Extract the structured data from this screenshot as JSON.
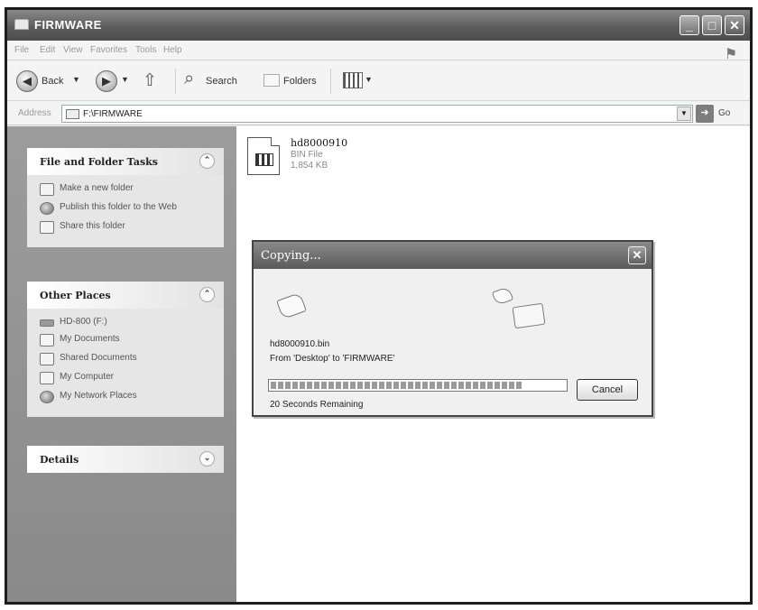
{
  "window": {
    "title": "FIRMWARE"
  },
  "titlebar_buttons": {
    "minimize": "_",
    "maximize": "□",
    "close": "✕"
  },
  "menu": [
    "File",
    "Edit",
    "View",
    "Favorites",
    "Tools",
    "Help"
  ],
  "toolbar": {
    "back_label": "Back",
    "search_label": "Search",
    "folders_label": "Folders"
  },
  "address": {
    "label": "Address",
    "path": "F:\\FIRMWARE",
    "go_label": "Go"
  },
  "sidebar": {
    "tasks": {
      "title": "File and Folder Tasks",
      "items": [
        {
          "label": "Make a new folder",
          "icon": "folder-new-icon"
        },
        {
          "label": "Publish this folder to the Web",
          "icon": "globe-icon"
        },
        {
          "label": "Share this folder",
          "icon": "share-icon"
        }
      ]
    },
    "other_places": {
      "title": "Other Places",
      "items": [
        {
          "label": "HD-800 (F:)",
          "icon": "drive-icon"
        },
        {
          "label": "My Documents",
          "icon": "documents-icon"
        },
        {
          "label": "Shared Documents",
          "icon": "shared-folder-icon"
        },
        {
          "label": "My Computer",
          "icon": "computer-icon"
        },
        {
          "label": "My Network Places",
          "icon": "network-icon"
        }
      ]
    },
    "details": {
      "title": "Details"
    }
  },
  "file": {
    "name": "hd8000910",
    "type": "BIN File",
    "size": "1,854 KB",
    "icon": "bin-file-icon"
  },
  "dialog": {
    "title": "Copying...",
    "filename": "hd8000910.bin",
    "from_to": "From 'Desktop' to 'FIRMWARE'",
    "progress_fraction": 0.86,
    "cancel_label": "Cancel",
    "remaining": "20 Seconds Remaining"
  }
}
